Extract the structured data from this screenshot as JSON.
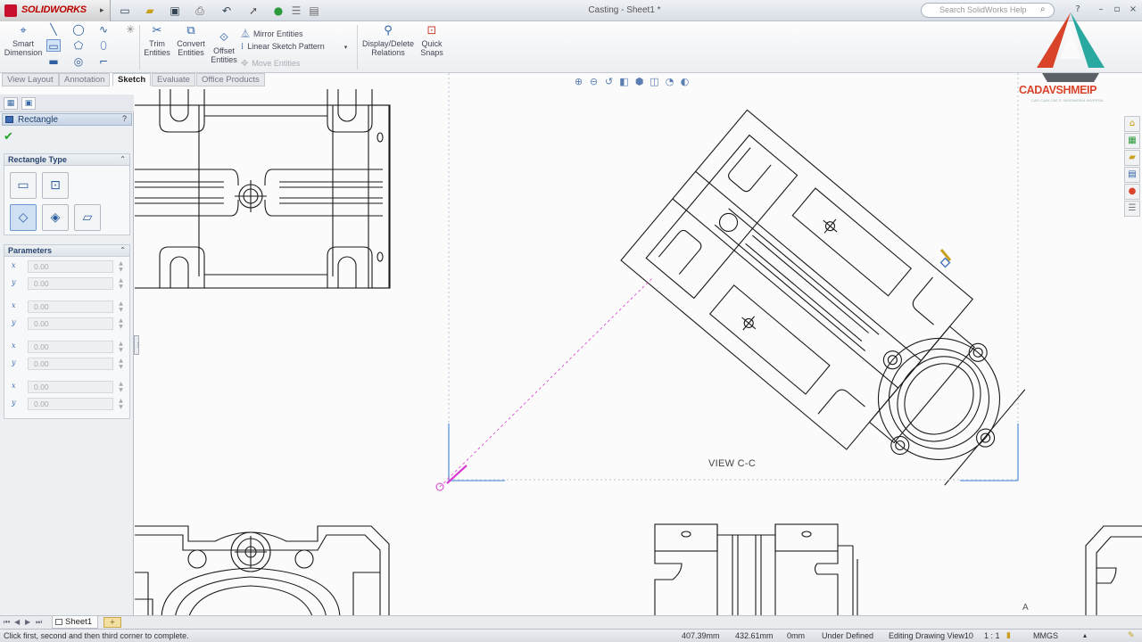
{
  "app": {
    "name": "SOLIDWORKS",
    "document_title": "Casting - Sheet1 *",
    "help_search_placeholder": "Search SolidWorks Help"
  },
  "ribbon": {
    "smart_dimension": "Smart Dimension",
    "trim_entities": "Trim Entities",
    "convert_entities": "Convert Entities",
    "offset_entities": "Offset Entities",
    "mirror_entities": "Mirror Entities",
    "linear_sketch_pattern": "Linear Sketch Pattern",
    "move_entities": "Move Entities",
    "display_delete_relations": "Display/Delete Relations",
    "quick_snaps": "Quick Snaps"
  },
  "tabs": [
    "View Layout",
    "Annotation",
    "Sketch",
    "Evaluate",
    "Office Products"
  ],
  "property_manager": {
    "title": "Rectangle",
    "help": "?",
    "rectangle_type_label": "Rectangle Type",
    "parameters_label": "Parameters",
    "parameters": [
      {
        "axis": "x",
        "value": "0.00"
      },
      {
        "axis": "y",
        "value": "0.00"
      },
      {
        "axis": "x",
        "value": "0.00"
      },
      {
        "axis": "y",
        "value": "0.00"
      },
      {
        "axis": "x",
        "value": "0.00"
      },
      {
        "axis": "y",
        "value": "0.00"
      },
      {
        "axis": "x",
        "value": "0.00"
      },
      {
        "axis": "y",
        "value": "0.00"
      }
    ]
  },
  "canvas": {
    "view_label": "VIEW C-C",
    "cursor_letter": "A"
  },
  "sheet_tabs": {
    "active": "Sheet1"
  },
  "statusbar": {
    "message": "Click first, second and then third corner to complete.",
    "x": "407.39mm",
    "y": "432.61mm",
    "z": "0mm",
    "state": "Under Defined",
    "editing": "Editing Drawing View10",
    "scale": "1 : 1",
    "units": "MMGS"
  },
  "brand": {
    "name": "CADAVSHMEIP",
    "tagline": "CAD CAM CAE E INGENIERIA INVERSA"
  },
  "colors": {
    "accent": "#2f63a8",
    "brand_red": "#d8432a",
    "brand_teal": "#2aa9a0",
    "selection_blue": "#7aa8e0",
    "sketch_magenta": "#d83bd0"
  }
}
